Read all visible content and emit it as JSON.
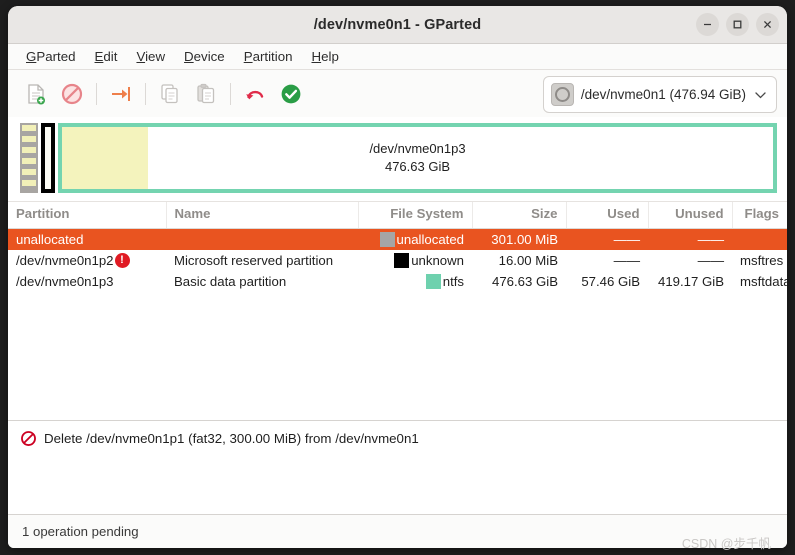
{
  "window": {
    "title": "/dev/nvme0n1 - GParted",
    "controls": [
      {
        "name": "minimize",
        "glyph": "–"
      },
      {
        "name": "maximize",
        "glyph": "□"
      },
      {
        "name": "close",
        "glyph": "✕"
      }
    ]
  },
  "menubar": {
    "items": [
      {
        "mnemonic": "G",
        "rest": "Parted"
      },
      {
        "mnemonic": "E",
        "rest": "dit"
      },
      {
        "mnemonic": "V",
        "rest": "iew"
      },
      {
        "mnemonic": "D",
        "rest": "evice"
      },
      {
        "mnemonic": "P",
        "rest": "artition"
      },
      {
        "mnemonic": "H",
        "rest": "elp"
      }
    ]
  },
  "toolbar": {
    "buttons": [
      {
        "icon": "new-partition-icon",
        "label": "New",
        "enabled": false
      },
      {
        "icon": "delete-partition-icon",
        "label": "Delete",
        "enabled": true
      },
      {
        "icon": "resize-move-icon",
        "label": "Resize/Move",
        "enabled": true
      },
      {
        "icon": "copy-icon",
        "label": "Copy",
        "enabled": false
      },
      {
        "icon": "paste-icon",
        "label": "Paste",
        "enabled": false
      },
      {
        "icon": "undo-icon",
        "label": "Undo All Operations",
        "enabled": true
      },
      {
        "icon": "apply-icon",
        "label": "Apply All Operations",
        "enabled": true
      }
    ],
    "device_selector": {
      "icon": "disk-icon",
      "value": "/dev/nvme0n1 (476.94 GiB)",
      "chevron": "⌄"
    }
  },
  "diskview": {
    "blocks": [
      {
        "name": "unallocated",
        "kind": "unallocated",
        "label": "",
        "size_label": ""
      },
      {
        "name": "/dev/nvme0n1p2",
        "kind": "unknown",
        "label": "",
        "size_label": ""
      },
      {
        "name": "/dev/nvme0n1p3",
        "kind": "ntfs",
        "label": "/dev/nvme0n1p3",
        "size_label": "476.63 GiB",
        "used_percent": 12.05
      }
    ]
  },
  "partition_table": {
    "columns": [
      "Partition",
      "Name",
      "File System",
      "Size",
      "Used",
      "Unused",
      "Flags"
    ],
    "rows": [
      {
        "partition": "unallocated",
        "warning": false,
        "name": "",
        "filesystem": "unallocated",
        "swatch": "#a5a5a5",
        "size": "301.00 MiB",
        "used": "——",
        "unused": "——",
        "flags": "",
        "selected": true
      },
      {
        "partition": "/dev/nvme0n1p2",
        "warning": true,
        "warning_glyph": "!",
        "name": "Microsoft reserved partition",
        "filesystem": "unknown",
        "swatch": "#000000",
        "size": "16.00 MiB",
        "used": "——",
        "unused": "——",
        "flags": "msftres",
        "selected": false
      },
      {
        "partition": "/dev/nvme0n1p3",
        "warning": false,
        "name": "Basic data partition",
        "filesystem": "ntfs",
        "swatch": "#6ed1ae",
        "size": "476.63 GiB",
        "used": "57.46 GiB",
        "unused": "419.17 GiB",
        "flags": "msftdata",
        "selected": false
      }
    ]
  },
  "pending_operations": {
    "items": [
      {
        "icon": "delete-operation-icon",
        "text": "Delete /dev/nvme0n1p1 (fat32, 300.00 MiB) from /dev/nvme0n1"
      }
    ]
  },
  "statusbar": {
    "text": "1 operation pending"
  },
  "watermark": {
    "text": "CSDN @步千帆"
  },
  "colors": {
    "selection": "#e95420",
    "ntfs": "#6ed1ae",
    "unallocated": "#a5a5a5",
    "unknown": "#000000",
    "used_area": "#f4f3bd",
    "apply_green": "#2a9d46",
    "undo_red": "#e02b49",
    "warning_red": "#e01b24"
  }
}
